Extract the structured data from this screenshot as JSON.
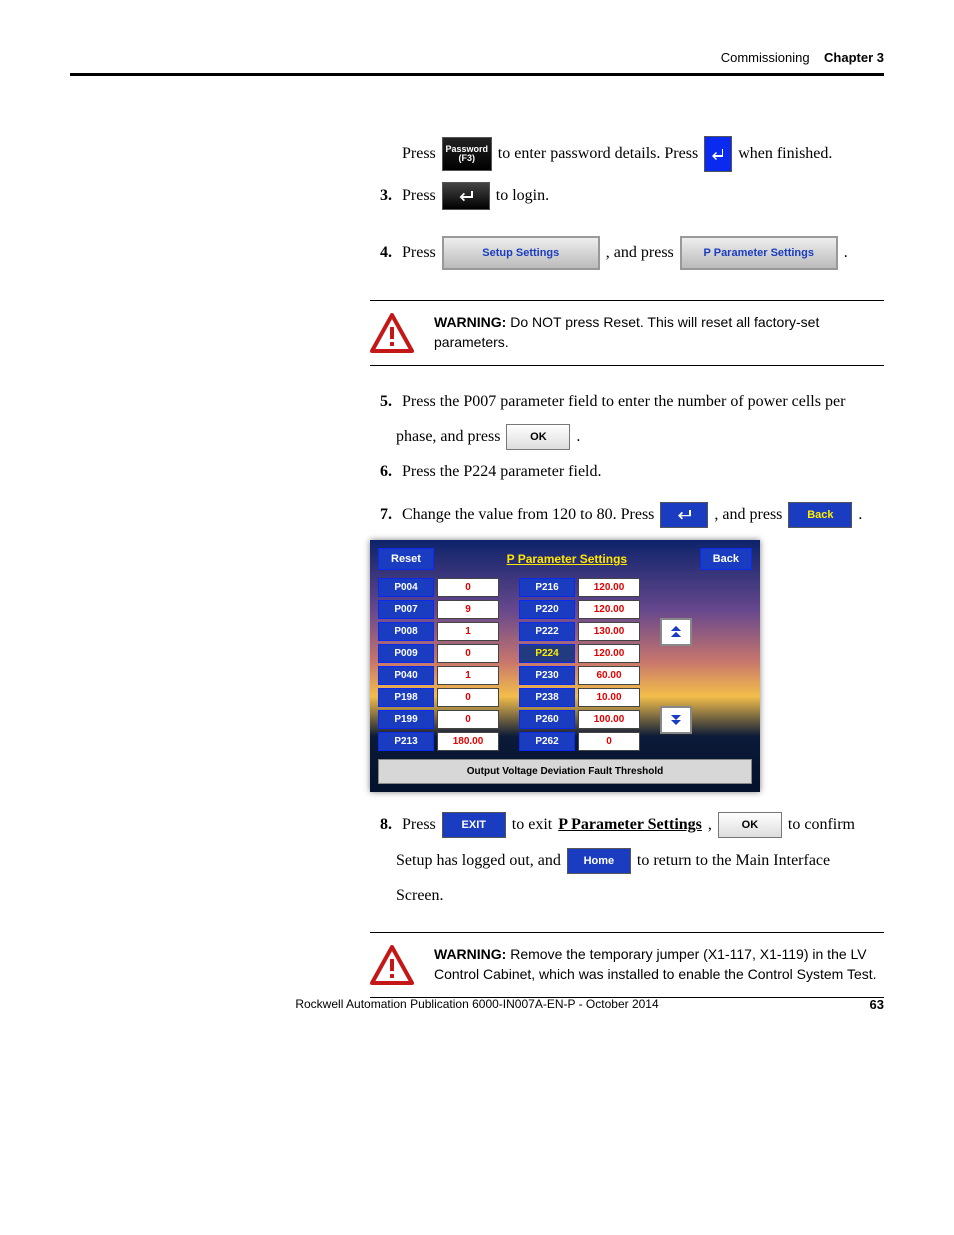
{
  "header": {
    "section": "Commissioning",
    "chapter": "Chapter 3"
  },
  "steps": {
    "s2": {
      "press": "Press",
      "passwordBtnTop": "Password",
      "passwordBtnSub": "(F3)",
      "mid": "to enter password details. Press",
      "end": "when finished."
    },
    "s3": {
      "num": "3.",
      "press": "Press",
      "end": "to login."
    },
    "s4": {
      "num": "4.",
      "press": "Press",
      "setup": "Setup Settings",
      "mid": ", and press",
      "pparam": "P Parameter Settings"
    },
    "s5": {
      "num": "5.",
      "line1": "Press the P007 parameter field to enter the number of power cells per",
      "line2a": "phase, and press",
      "ok": "OK",
      "line2b": "."
    },
    "s6": {
      "num": "6.",
      "text": "Press the P224 parameter field."
    },
    "s7": {
      "num": "7.",
      "a": "Change the value from 120 to 80. Press",
      "mid": ", and press",
      "back": "Back",
      "end": "."
    },
    "s8": {
      "num": "8.",
      "press": "Press",
      "exit": "EXIT",
      "mid1": "to exit",
      "link": "P Parameter Settings",
      "comma": ",",
      "ok": "OK",
      "mid2": "to confirm",
      "line2a": "Setup has logged out, and",
      "home": "Home",
      "line2b": "to return to the Main Interface",
      "line3": "Screen."
    }
  },
  "warnings": {
    "w1": {
      "label": "WARNING:",
      "text": "Do NOT press Reset. This will reset all factory-set parameters."
    },
    "w2": {
      "label": "WARNING:",
      "text": "Remove the temporary jumper (X1-117, X1-119) in the LV Control Cabinet, which was installed to enable the Control System Test."
    }
  },
  "chart_data": {
    "type": "table",
    "title": "P Parameter Settings",
    "topButtons": {
      "reset": "Reset",
      "back": "Back"
    },
    "bottomLabel": "Output Voltage Deviation Fault Threshold",
    "left": [
      {
        "param": "P004",
        "value": "0"
      },
      {
        "param": "P007",
        "value": "9"
      },
      {
        "param": "P008",
        "value": "1"
      },
      {
        "param": "P009",
        "value": "0"
      },
      {
        "param": "P040",
        "value": "1"
      },
      {
        "param": "P198",
        "value": "0"
      },
      {
        "param": "P199",
        "value": "0"
      },
      {
        "param": "P213",
        "value": "180.00"
      }
    ],
    "right": [
      {
        "param": "P216",
        "value": "120.00"
      },
      {
        "param": "P220",
        "value": "120.00"
      },
      {
        "param": "P222",
        "value": "130.00"
      },
      {
        "param": "P224",
        "value": "120.00",
        "selected": true
      },
      {
        "param": "P230",
        "value": "60.00"
      },
      {
        "param": "P238",
        "value": "10.00"
      },
      {
        "param": "P260",
        "value": "100.00"
      },
      {
        "param": "P262",
        "value": "0"
      }
    ]
  },
  "footer": {
    "pub": "Rockwell Automation Publication 6000-IN007A-EN-P - October 2014",
    "page": "63"
  }
}
